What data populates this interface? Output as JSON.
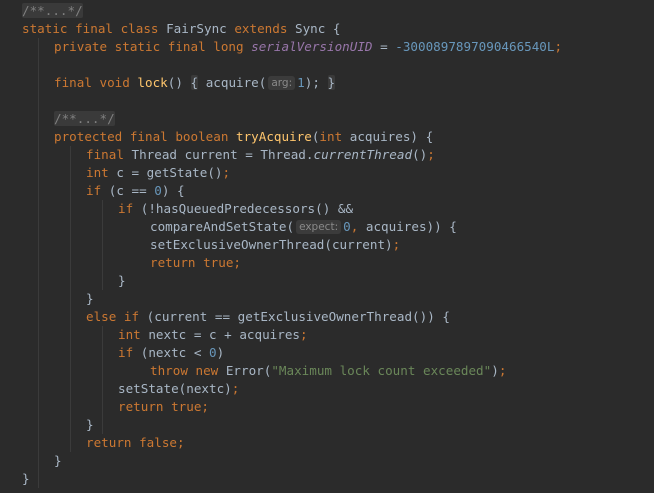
{
  "editor": {
    "lines": [
      {
        "indent": 0,
        "tokens": [
          {
            "t": "/**...*/",
            "c": "fold"
          }
        ]
      },
      {
        "indent": 0,
        "tokens": [
          {
            "t": "static ",
            "c": "kw"
          },
          {
            "t": "final ",
            "c": "kw"
          },
          {
            "t": "class ",
            "c": "kw"
          },
          {
            "t": "FairSync ",
            "c": "plain"
          },
          {
            "t": "extends ",
            "c": "kw"
          },
          {
            "t": "Sync {",
            "c": "plain"
          }
        ]
      },
      {
        "indent": 1,
        "tokens": [
          {
            "t": "private ",
            "c": "kw"
          },
          {
            "t": "static ",
            "c": "kw"
          },
          {
            "t": "final ",
            "c": "kw"
          },
          {
            "t": "long ",
            "c": "kw"
          },
          {
            "t": "serialVersionUID",
            "c": "field"
          },
          {
            "t": " = ",
            "c": "plain"
          },
          {
            "t": "-3000897897090466540L",
            "c": "num"
          },
          {
            "t": ";",
            "c": "kw"
          }
        ]
      },
      {
        "indent": 0,
        "tokens": []
      },
      {
        "indent": 1,
        "tokens": [
          {
            "t": "final ",
            "c": "kw"
          },
          {
            "t": "void ",
            "c": "kw"
          },
          {
            "t": "lock",
            "c": "fn"
          },
          {
            "t": "() ",
            "c": "plain"
          },
          {
            "t": "{",
            "c": "bracefold"
          },
          {
            "t": " acquire(",
            "c": "plain"
          },
          {
            "t": "arg:",
            "c": "hint"
          },
          {
            "t": "1",
            "c": "num"
          },
          {
            "t": ");",
            "c": "plain"
          },
          {
            "t": " ",
            "c": "plain"
          },
          {
            "t": "}",
            "c": "bracefold"
          }
        ]
      },
      {
        "indent": 0,
        "tokens": []
      },
      {
        "indent": 1,
        "tokens": [
          {
            "t": "/**...*/",
            "c": "fold"
          }
        ]
      },
      {
        "indent": 1,
        "tokens": [
          {
            "t": "protected ",
            "c": "kw"
          },
          {
            "t": "final ",
            "c": "kw"
          },
          {
            "t": "boolean ",
            "c": "kw"
          },
          {
            "t": "tryAcquire",
            "c": "fn"
          },
          {
            "t": "(",
            "c": "plain"
          },
          {
            "t": "int ",
            "c": "kw"
          },
          {
            "t": "acquires) {",
            "c": "plain"
          }
        ]
      },
      {
        "indent": 2,
        "tokens": [
          {
            "t": "final ",
            "c": "kw"
          },
          {
            "t": "Thread current = Thread.",
            "c": "plain"
          },
          {
            "t": "currentThread",
            "c": "ital"
          },
          {
            "t": "()",
            "c": "plain"
          },
          {
            "t": ";",
            "c": "kw"
          }
        ]
      },
      {
        "indent": 2,
        "tokens": [
          {
            "t": "int ",
            "c": "kw"
          },
          {
            "t": "c = getState()",
            "c": "plain"
          },
          {
            "t": ";",
            "c": "kw"
          }
        ]
      },
      {
        "indent": 2,
        "tokens": [
          {
            "t": "if ",
            "c": "kw"
          },
          {
            "t": "(c == ",
            "c": "plain"
          },
          {
            "t": "0",
            "c": "num"
          },
          {
            "t": ") {",
            "c": "plain"
          }
        ]
      },
      {
        "indent": 3,
        "tokens": [
          {
            "t": "if ",
            "c": "kw"
          },
          {
            "t": "(!hasQueuedPredecessors() &&",
            "c": "plain"
          }
        ]
      },
      {
        "indent": 4,
        "tokens": [
          {
            "t": "compareAndSetState(",
            "c": "plain"
          },
          {
            "t": "expect:",
            "c": "hint"
          },
          {
            "t": "0",
            "c": "num"
          },
          {
            "t": ", ",
            "c": "kw"
          },
          {
            "t": "acquires)) {",
            "c": "plain"
          }
        ]
      },
      {
        "indent": 4,
        "tokens": [
          {
            "t": "setExclusiveOwnerThread(current)",
            "c": "plain"
          },
          {
            "t": ";",
            "c": "kw"
          }
        ]
      },
      {
        "indent": 4,
        "tokens": [
          {
            "t": "return ",
            "c": "kw"
          },
          {
            "t": "true",
            "c": "kw"
          },
          {
            "t": ";",
            "c": "kw"
          }
        ]
      },
      {
        "indent": 3,
        "tokens": [
          {
            "t": "}",
            "c": "plain"
          }
        ]
      },
      {
        "indent": 2,
        "tokens": [
          {
            "t": "}",
            "c": "plain"
          }
        ]
      },
      {
        "indent": 2,
        "tokens": [
          {
            "t": "else ",
            "c": "kw"
          },
          {
            "t": "if ",
            "c": "kw"
          },
          {
            "t": "(current == getExclusiveOwnerThread()) {",
            "c": "plain"
          }
        ]
      },
      {
        "indent": 3,
        "tokens": [
          {
            "t": "int ",
            "c": "kw"
          },
          {
            "t": "nextc = c + acquires",
            "c": "plain"
          },
          {
            "t": ";",
            "c": "kw"
          }
        ]
      },
      {
        "indent": 3,
        "tokens": [
          {
            "t": "if ",
            "c": "kw"
          },
          {
            "t": "(nextc < ",
            "c": "plain"
          },
          {
            "t": "0",
            "c": "num"
          },
          {
            "t": ")",
            "c": "plain"
          }
        ]
      },
      {
        "indent": 4,
        "tokens": [
          {
            "t": "throw ",
            "c": "kw"
          },
          {
            "t": "new ",
            "c": "kw"
          },
          {
            "t": "Error(",
            "c": "plain"
          },
          {
            "t": "\"Maximum lock count exceeded\"",
            "c": "str"
          },
          {
            "t": ")",
            "c": "plain"
          },
          {
            "t": ";",
            "c": "kw"
          }
        ]
      },
      {
        "indent": 3,
        "tokens": [
          {
            "t": "setState(nextc)",
            "c": "plain"
          },
          {
            "t": ";",
            "c": "kw"
          }
        ]
      },
      {
        "indent": 3,
        "tokens": [
          {
            "t": "return ",
            "c": "kw"
          },
          {
            "t": "true",
            "c": "kw"
          },
          {
            "t": ";",
            "c": "kw"
          }
        ]
      },
      {
        "indent": 2,
        "tokens": [
          {
            "t": "}",
            "c": "plain"
          }
        ]
      },
      {
        "indent": 2,
        "tokens": [
          {
            "t": "return ",
            "c": "kw"
          },
          {
            "t": "false",
            "c": "kw"
          },
          {
            "t": ";",
            "c": "kw"
          }
        ]
      },
      {
        "indent": 1,
        "tokens": [
          {
            "t": "}",
            "c": "plain"
          }
        ]
      },
      {
        "indent": 0,
        "tokens": [
          {
            "t": "}",
            "c": "plain"
          }
        ]
      }
    ]
  },
  "theme": {
    "background": "#2b2b2b",
    "keyword": "#cc7832",
    "function": "#ffc66d",
    "number": "#6897bb",
    "string": "#6a8759",
    "comment": "#808080",
    "field": "#9876aa",
    "text": "#a9b7c6"
  }
}
